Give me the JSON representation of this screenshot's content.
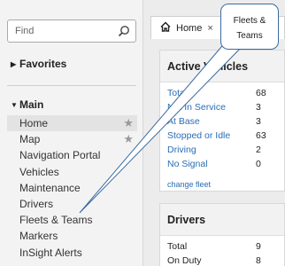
{
  "sidebar": {
    "search": {
      "placeholder": "Find",
      "value": ""
    },
    "favorites_label": "Favorites",
    "main_label": "Main",
    "items": [
      {
        "label": "Home",
        "starred": true
      },
      {
        "label": "Map",
        "starred": true
      },
      {
        "label": "Navigation Portal"
      },
      {
        "label": "Vehicles"
      },
      {
        "label": "Maintenance"
      },
      {
        "label": "Drivers"
      },
      {
        "label": "Fleets & Teams"
      },
      {
        "label": "Markers"
      },
      {
        "label": "InSight Alerts"
      }
    ]
  },
  "tabs": [
    {
      "label": "Home",
      "close": "×"
    }
  ],
  "active_vehicles": {
    "title": "Active Vehicles",
    "rows": [
      {
        "label": "Total",
        "value": "68"
      },
      {
        "label": "Not In Service",
        "value": "3"
      },
      {
        "label": "At Base",
        "value": "3"
      },
      {
        "label": "Stopped or Idle",
        "value": "63"
      },
      {
        "label": "Driving",
        "value": "2"
      },
      {
        "label": "No Signal",
        "value": "0"
      }
    ],
    "link": "change fleet"
  },
  "drivers": {
    "title": "Drivers",
    "rows": [
      {
        "label": "Total",
        "value": "9"
      },
      {
        "label": "On Duty",
        "value": "8"
      }
    ]
  },
  "callout": {
    "text": "Fleets & Teams"
  },
  "colors": {
    "link": "#2a6db5",
    "callout_border": "#3a6aa0",
    "sidebar_bg": "#f3f3f3",
    "active_item_bg": "#e3e3e3"
  }
}
